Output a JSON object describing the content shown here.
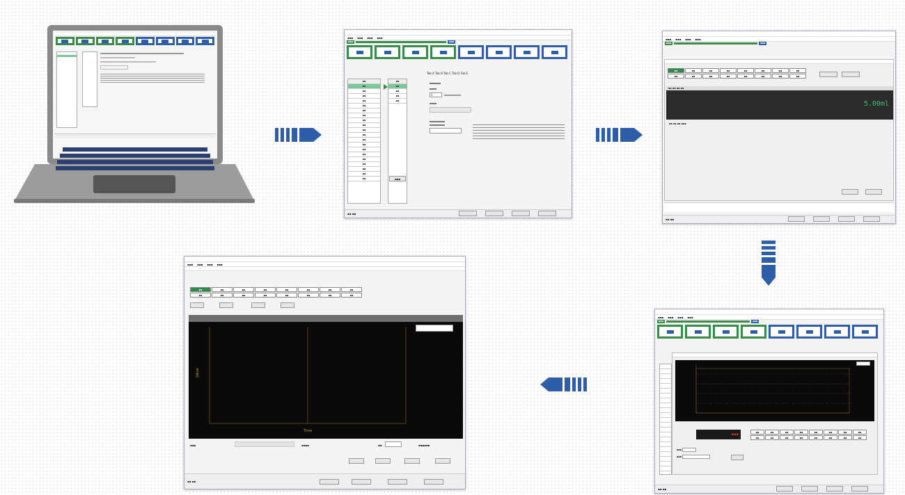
{
  "steps": [
    {
      "label": "Step 1",
      "color": "green"
    },
    {
      "label": "Step 2",
      "color": "green"
    },
    {
      "label": "Step 3",
      "color": "green"
    },
    {
      "label": "Step 4",
      "color": "green"
    },
    {
      "label": "Step 5",
      "color": "blue"
    },
    {
      "label": "Step 6",
      "color": "blue"
    },
    {
      "label": "Step 7",
      "color": "blue"
    },
    {
      "label": "Step 8",
      "color": "blue"
    }
  ],
  "colors": {
    "green": "#3a8a4a",
    "blue": "#2f5ea8",
    "dark": "#0a0a0a",
    "arrow": "#2f5ea8",
    "laptop": "#6c6c6c"
  },
  "dialog2": {
    "tabs": "Tab A  Tab B  Tab C  Tab D  Tab E",
    "field_value": "1",
    "count": "1:00"
  },
  "dialog3": {
    "readout": "5.00ml"
  },
  "dialog5": {
    "x_label": "Time",
    "y_label": "Value"
  },
  "icons": {
    "arrow": "arrow-right-icon",
    "laptop": "laptop-icon"
  }
}
